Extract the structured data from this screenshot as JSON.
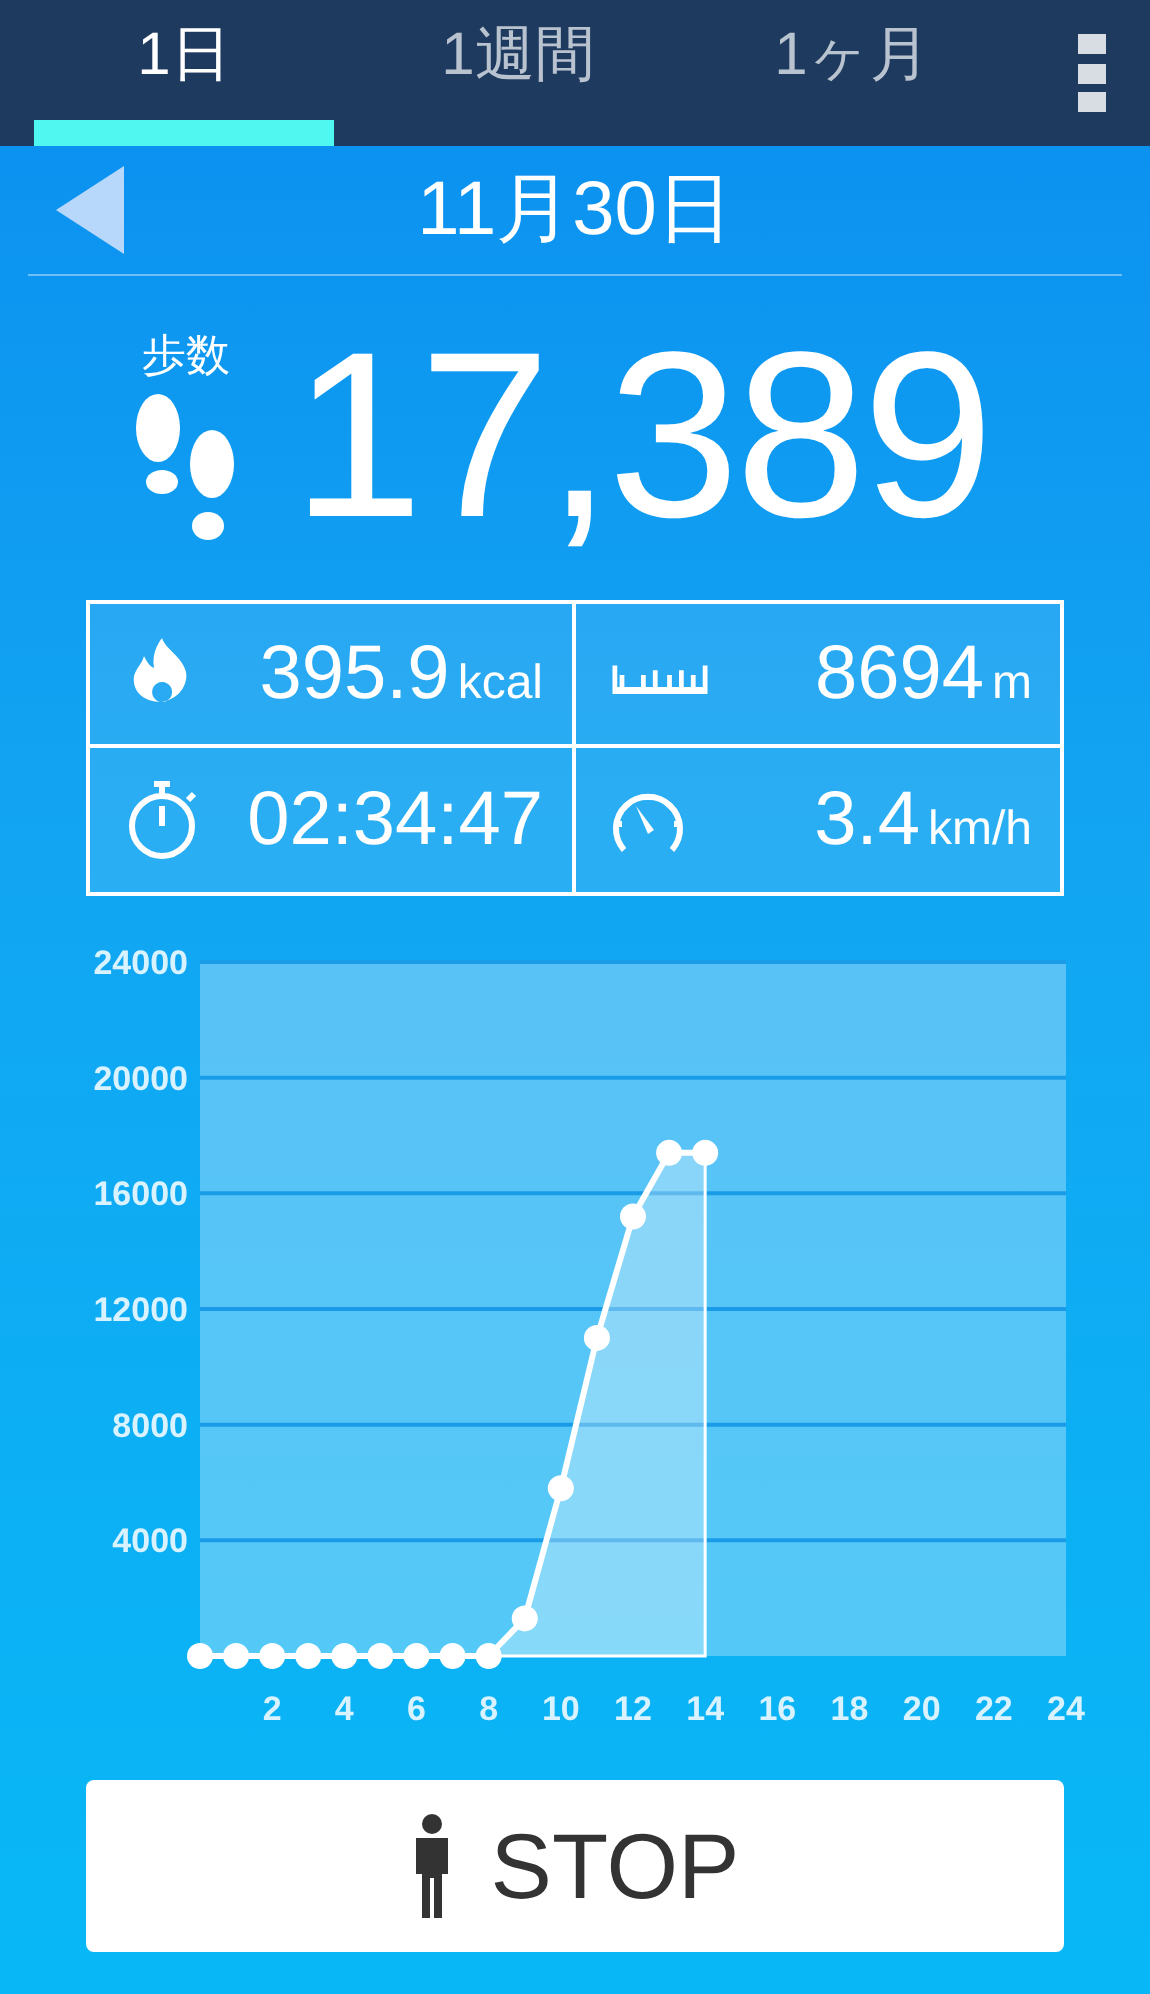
{
  "tabs": [
    {
      "label": "1日",
      "selected": true
    },
    {
      "label": "1週間",
      "selected": false
    },
    {
      "label": "1ヶ月",
      "selected": false
    }
  ],
  "date": "11月30日",
  "steps": {
    "label": "歩数",
    "value": "17,389"
  },
  "stats": [
    {
      "kind": "calories",
      "value": "395.9",
      "unit": "kcal"
    },
    {
      "kind": "distance",
      "value": "8694",
      "unit": "m"
    },
    {
      "kind": "time",
      "value": "02:34:47"
    },
    {
      "kind": "speed",
      "value": "3.4",
      "unit": "km/h"
    }
  ],
  "chart": {
    "chart_data": {
      "type": "area",
      "x": [
        0,
        1,
        2,
        3,
        4,
        5,
        6,
        7,
        8,
        9,
        10,
        11,
        12,
        13,
        14
      ],
      "series": [
        {
          "color": "#ffffff",
          "values": [
            0,
            0,
            0,
            0,
            0,
            0,
            0,
            0,
            0,
            1300,
            5800,
            11000,
            15200,
            17400,
            17400
          ]
        }
      ],
      "grid": true,
      "xlim": [
        0,
        24
      ],
      "ylim": [
        0,
        24000
      ],
      "xticks": [
        2,
        4,
        6,
        8,
        10,
        12,
        14,
        16,
        18,
        20,
        22,
        24
      ],
      "yticks": [
        4000,
        8000,
        12000,
        16000,
        20000,
        24000
      ]
    }
  },
  "stop_button": {
    "label": "STOP"
  }
}
